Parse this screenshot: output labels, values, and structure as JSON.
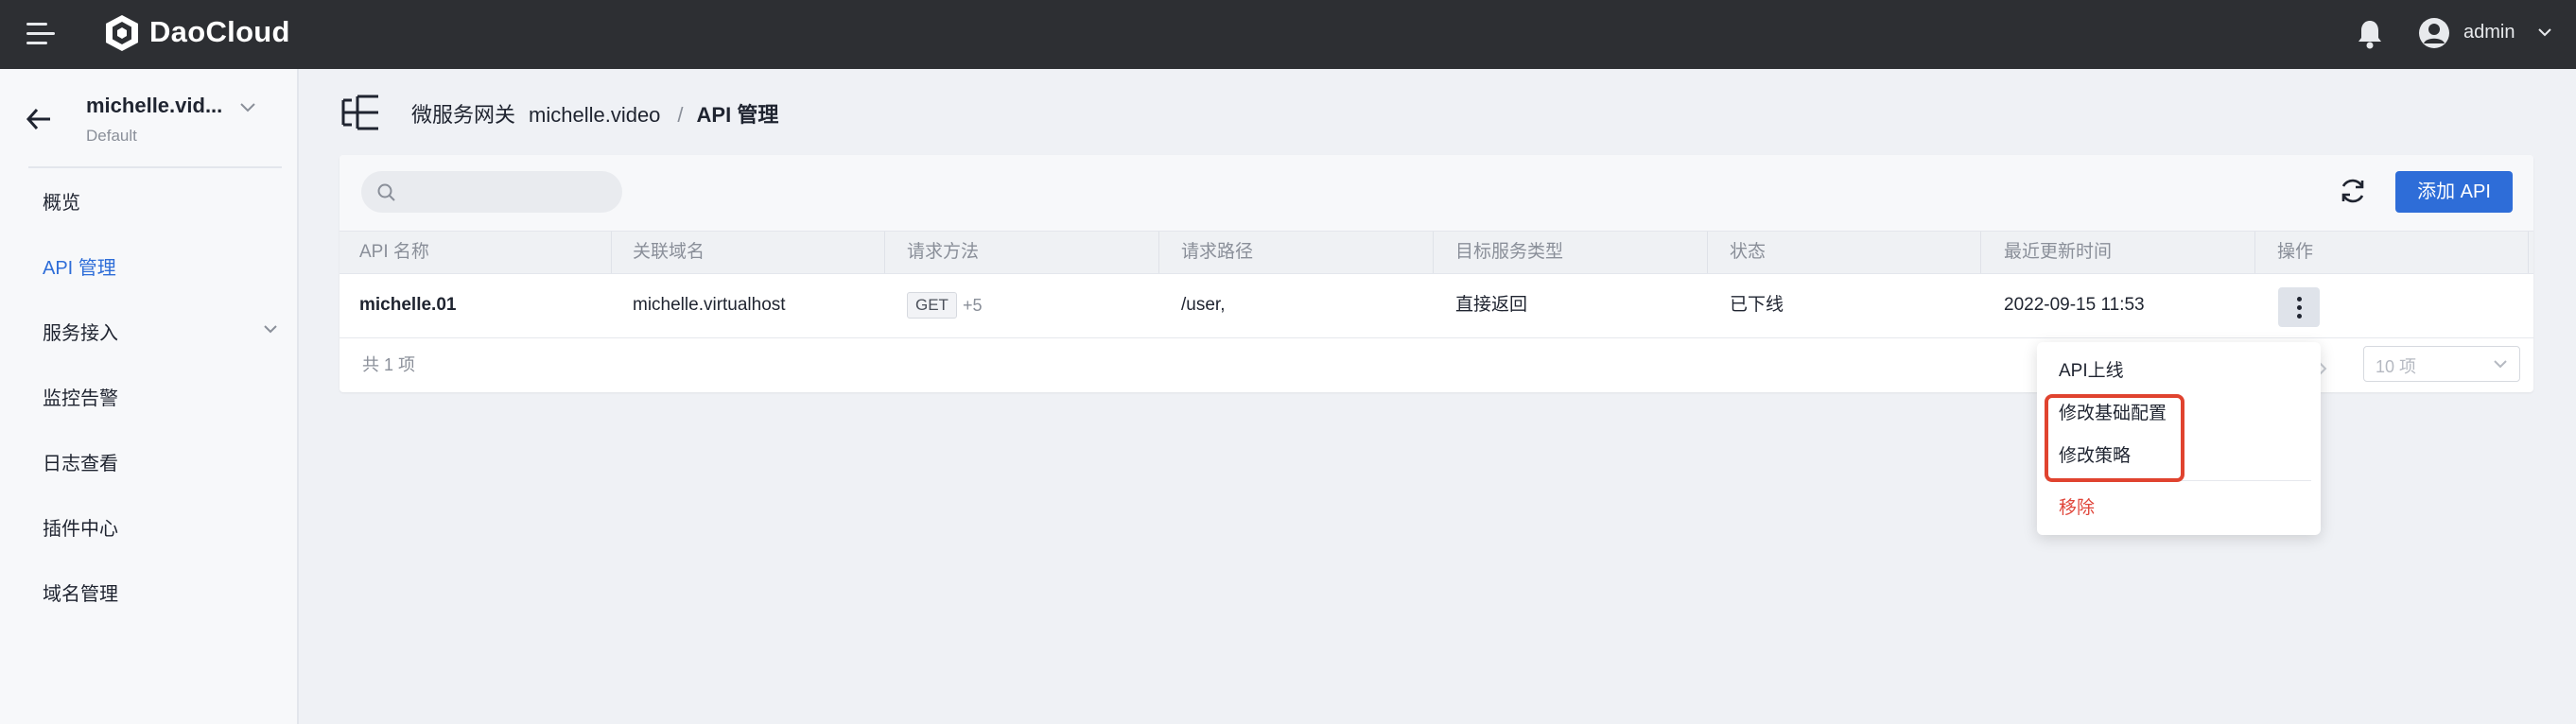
{
  "header": {
    "brand": "DaoCloud",
    "username": "admin"
  },
  "sidebar": {
    "workspace_name": "michelle.vid...",
    "workspace_sub": "Default",
    "items": [
      {
        "label": "概览"
      },
      {
        "label": "API 管理",
        "active": true
      },
      {
        "label": "服务接入",
        "expandable": true
      },
      {
        "label": "监控告警"
      },
      {
        "label": "日志查看"
      },
      {
        "label": "插件中心"
      },
      {
        "label": "域名管理"
      }
    ]
  },
  "breadcrumb": {
    "root": "微服务网关",
    "gateway": "michelle.video",
    "separator": "/",
    "current": "API 管理"
  },
  "toolbar": {
    "search_placeholder": "",
    "add_label": "添加 API"
  },
  "table": {
    "columns": [
      "API 名称",
      "关联域名",
      "请求方法",
      "请求路径",
      "目标服务类型",
      "状态",
      "最近更新时间",
      "操作"
    ],
    "rows": [
      {
        "name": "michelle.01",
        "domain": "michelle.virtualhost",
        "method": "GET",
        "method_more": "+5",
        "path": "/user,",
        "target_type": "直接返回",
        "status": "已下线",
        "updated": "2022-09-15 11:53"
      }
    ],
    "total": "共 1 项",
    "page_size": "10 项"
  },
  "action_menu": {
    "items": [
      "API上线",
      "修改基础配置",
      "修改策略"
    ],
    "danger_item": "移除"
  },
  "colors": {
    "accent": "#2e6dd8",
    "topbar": "#2d2f33",
    "danger": "#e0453a",
    "highlight_box": "#e0432f"
  }
}
